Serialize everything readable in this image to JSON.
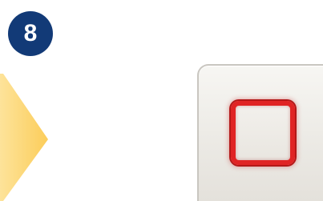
{
  "step": {
    "number": "8"
  },
  "colors": {
    "badge": "#123a77",
    "arrow": "#fdd36a",
    "stop_border": "#e02424",
    "tile": "#eceae5"
  },
  "icons": {
    "arrow": "right-arrow-icon",
    "stop": "stop-square-icon"
  }
}
